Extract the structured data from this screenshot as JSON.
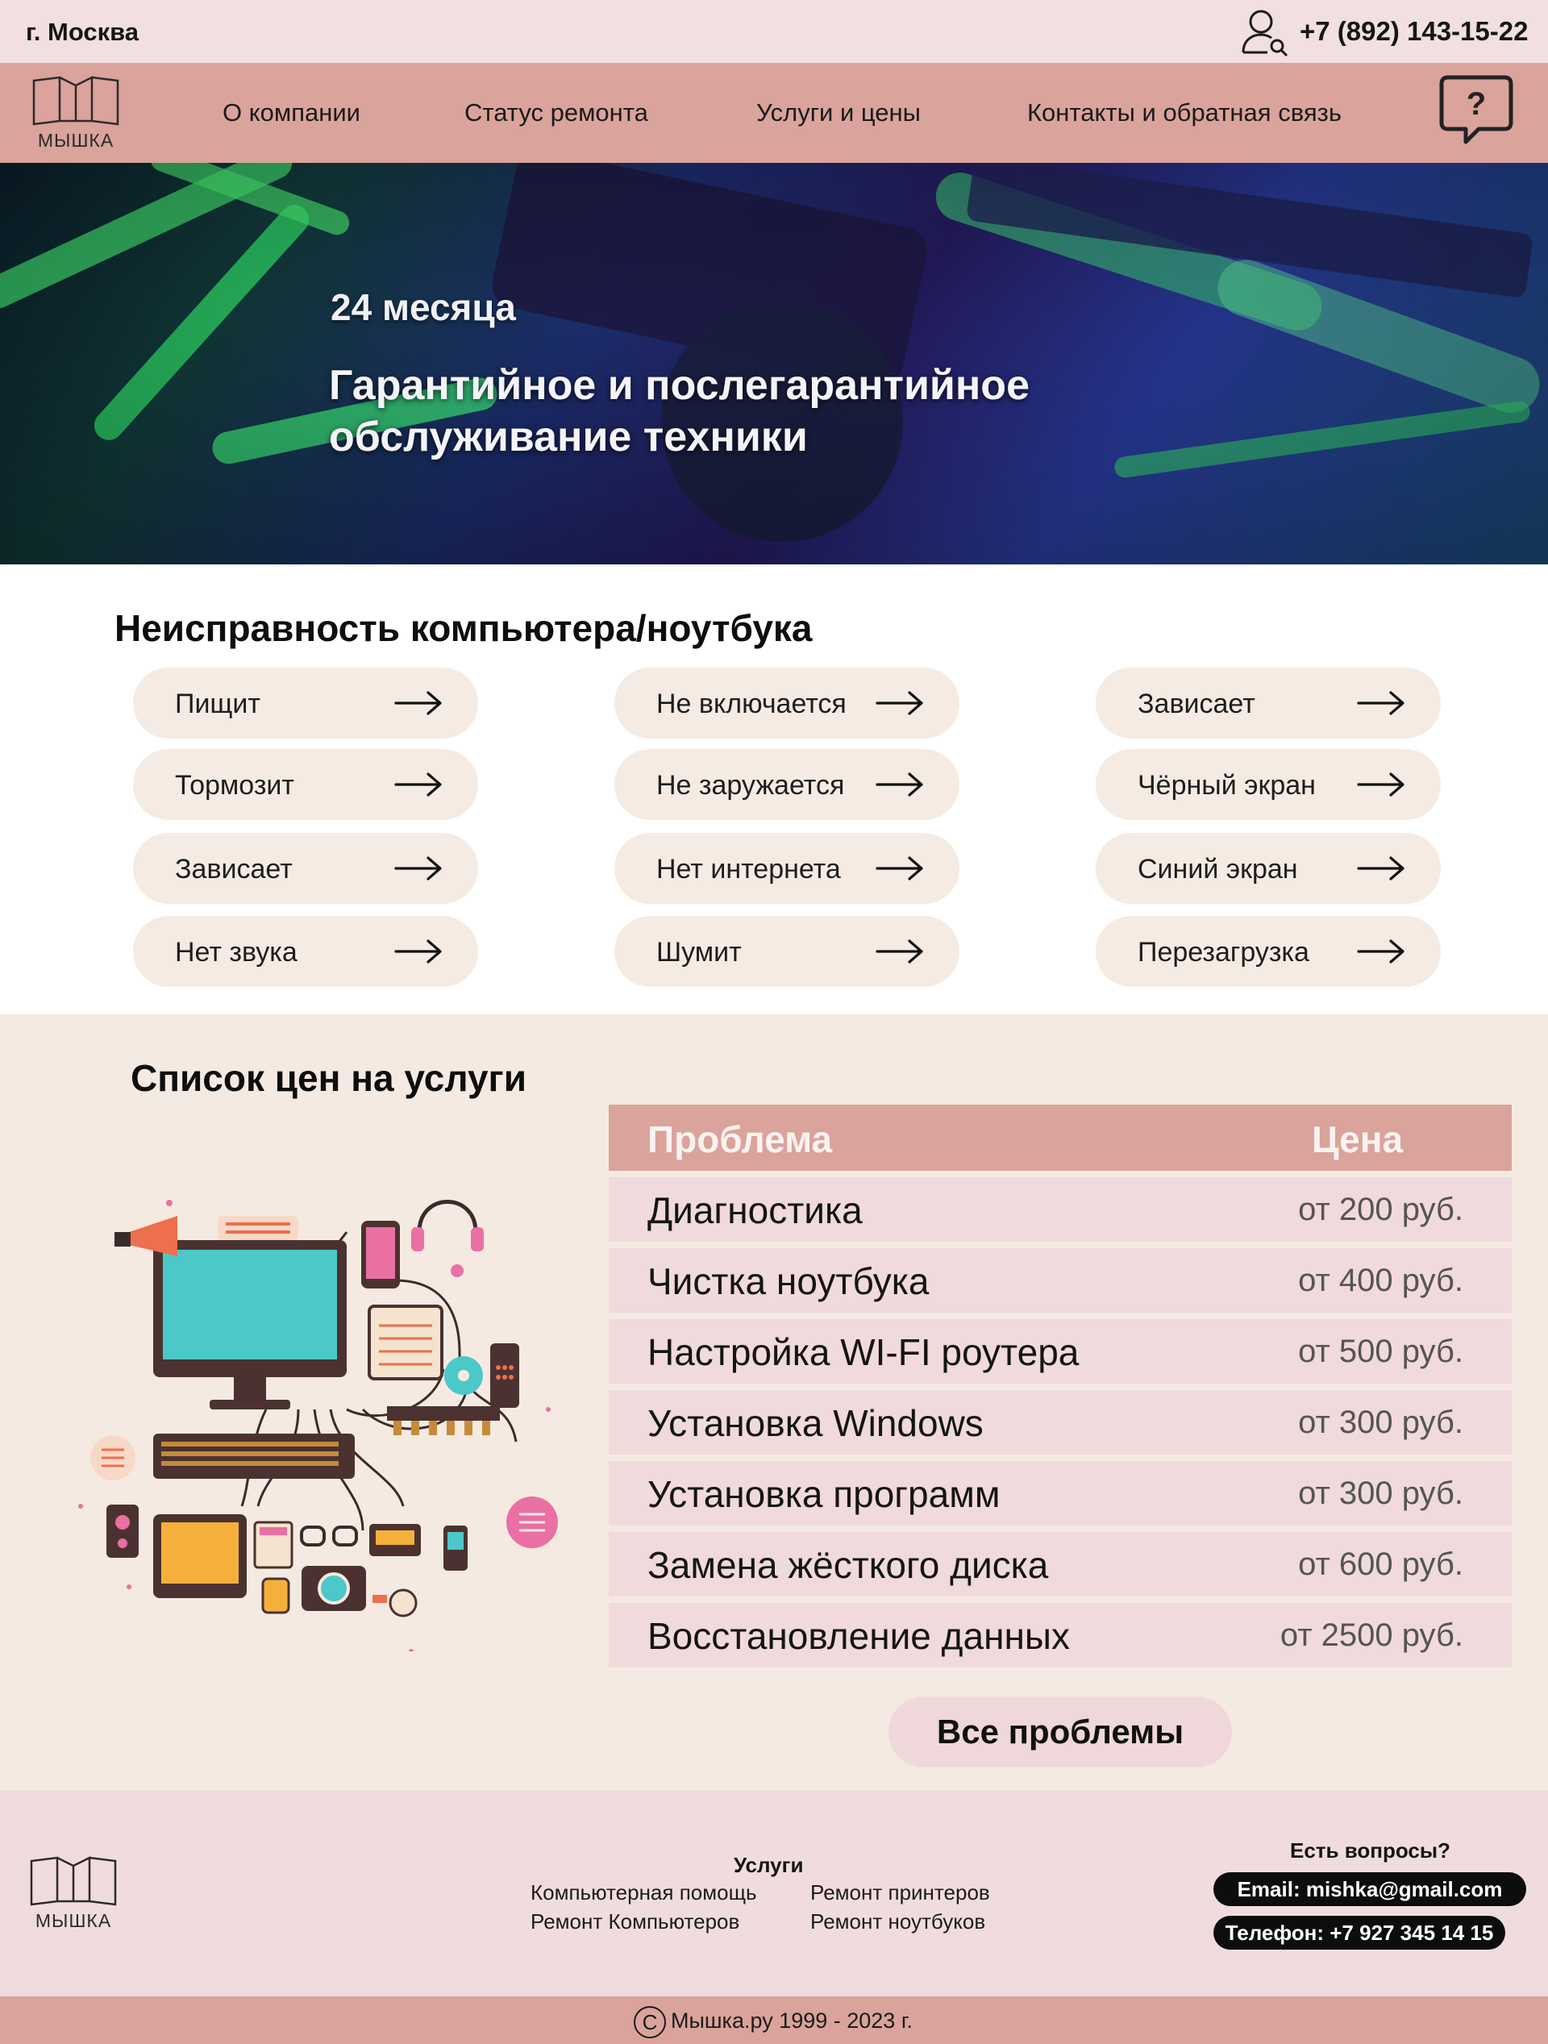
{
  "topbar": {
    "city": "г. Москва",
    "phone": "+7 (892) 143-15-22",
    "user_icon": "user-search-icon"
  },
  "nav": {
    "logo_text": "МЫШКА",
    "links": [
      "О компании",
      "Статус ремонта",
      "Услуги и цены",
      "Контакты и обратная связь"
    ],
    "help_icon": "question-chat-icon"
  },
  "hero": {
    "subtitle": "24 месяца",
    "title": "Гарантийное и послегарантийное обслуживание техники"
  },
  "problems": {
    "title": "Неисправность компьютера/ноутбука",
    "columns": [
      [
        "Пищит",
        "Тормозит",
        "Зависает",
        "Нет звука"
      ],
      [
        "Не включается",
        "Не заружается",
        "Нет интернета",
        "Шумит"
      ],
      [
        "Зависает",
        "Чёрный экран",
        "Синий экран",
        "Перезагрузка"
      ]
    ]
  },
  "prices": {
    "title": "Список цен на услуги",
    "header": {
      "problem": "Проблема",
      "price": "Цена"
    },
    "rows": [
      {
        "name": "Диагностика",
        "price": "от 200 руб."
      },
      {
        "name": "Чистка ноутбука",
        "price": "от 400 руб."
      },
      {
        "name": "Настройка WI-FI роутера",
        "price": "от 500 руб."
      },
      {
        "name": "Установка Windows",
        "price": "от 300 руб."
      },
      {
        "name": "Установка программ",
        "price": "от 300 руб."
      },
      {
        "name": "Замена жёсткого диска",
        "price": "от 600 руб."
      },
      {
        "name": "Восстановление данных",
        "price": "от 2500 руб."
      }
    ],
    "all_button": "Все проблемы"
  },
  "footer": {
    "logo_text": "МЫШКА",
    "services_title": "Услуги",
    "services": [
      "Компьютерная помощь",
      "Ремонт принтеров",
      "Ремонт Компьютеров",
      "Ремонт ноутбуков"
    ],
    "questions": "Есть вопросы?",
    "email": "Email: mishka@gmail.com",
    "phone": "Телефон: +7 927 345 14 15",
    "copyright": "Мышка.ру 1999 - 2023 г.",
    "copyright_symbol": "C"
  },
  "colors": {
    "nav": "#daa39b",
    "topbar": "#f1dfe1",
    "pill": "#f5ebe2",
    "prices_bg": "#f5eae1",
    "row": "#f1dadb"
  }
}
